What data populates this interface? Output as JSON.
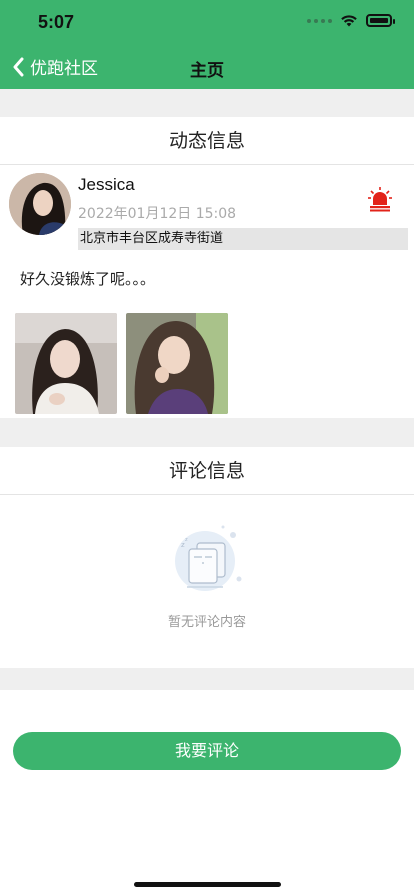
{
  "status_bar": {
    "time": "5:07"
  },
  "nav": {
    "back_label": "优跑社区",
    "title": "主页"
  },
  "dynamic": {
    "section_title": "动态信息",
    "username": "Jessica",
    "post_time": "2022年01月12日  15:08",
    "location": "北京市丰台区成寿寺街道",
    "content": "好久没锻炼了呢。。。",
    "photos": [
      "photo-1",
      "photo-2"
    ]
  },
  "comments": {
    "section_title": "评论信息",
    "empty_text": "暂无评论内容"
  },
  "footer": {
    "comment_button": "我要评论"
  },
  "colors": {
    "brand_green": "#3cb46e",
    "alarm_red": "#e2231a"
  },
  "icons": [
    "chevron-left-icon",
    "wifi-icon",
    "battery-icon",
    "alarm-icon",
    "empty-document-icon"
  ]
}
